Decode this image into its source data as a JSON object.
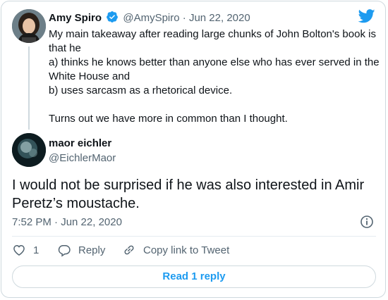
{
  "original_tweet": {
    "author_name": "Amy Spiro",
    "author_handle": "@AmySpiro",
    "separator": "·",
    "date": "Jun 22, 2020",
    "lines": [
      "My main takeaway after reading large chunks of John Bolton's book is that he",
      "a) thinks he knows better than anyone else who has ever served in the White House and",
      "b) uses sarcasm as a rhetorical device."
    ],
    "closing": "Turns out we have more in common than I thought."
  },
  "reply_tweet": {
    "author_name": "maor eichler",
    "author_handle": "@EichlerMaor",
    "text": "I would not be surprised if he was also interested in Amir Peretz’s moustache.",
    "time": "7:52 PM · Jun 22, 2020"
  },
  "actions": {
    "like_count": "1",
    "reply_label": "Reply",
    "copy_label": "Copy link to Tweet"
  },
  "read_replies_label": "Read 1 reply",
  "icons": [
    "verified-badge-icon",
    "twitter-bird-icon",
    "info-icon",
    "heart-icon",
    "reply-icon",
    "link-icon"
  ],
  "colors": {
    "accent": "#1d9bf0",
    "secondary_text": "#536471",
    "border": "#cfd9de"
  }
}
